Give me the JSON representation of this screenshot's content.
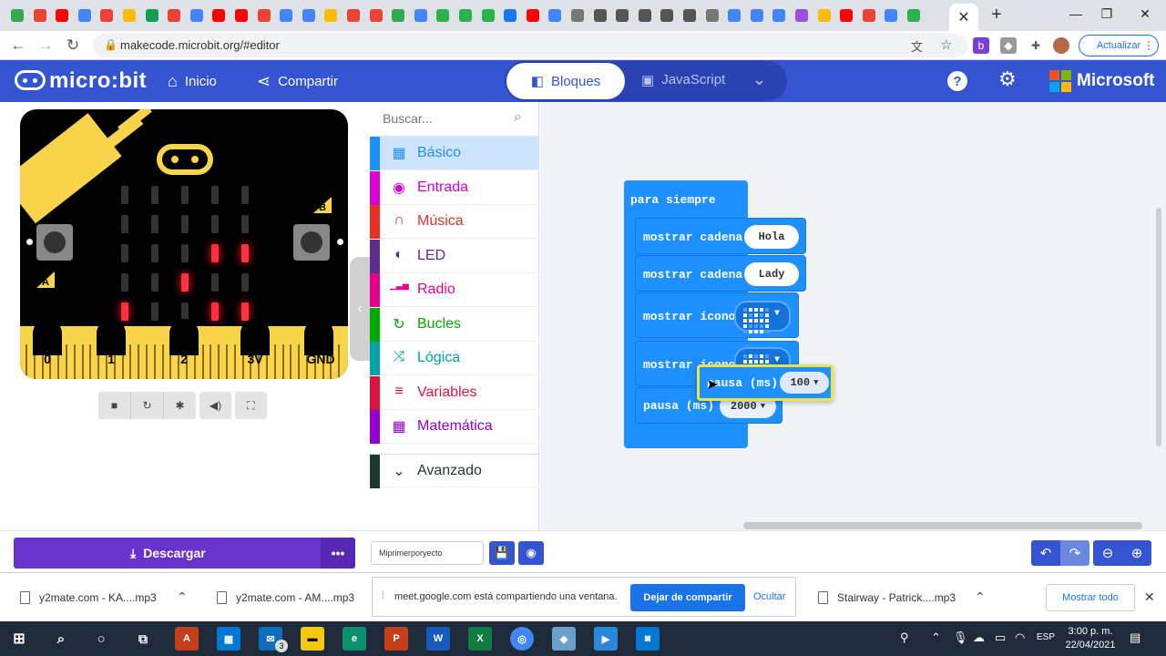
{
  "browser": {
    "url": "makecode.microbit.org/#editor",
    "update_label": "Actualizar",
    "tab_colors": [
      "#34a853",
      "#ea4335",
      "#ff0000",
      "#4285f4",
      "#ea4335",
      "#fbbc05",
      "#0f9d58",
      "#ea4335",
      "#4285f4",
      "#ff0000",
      "#ff0000",
      "#ea4335",
      "#4285f4",
      "#4285f4",
      "#fbbc05",
      "#ea4335",
      "#ea4335",
      "#34a853",
      "#4285f4",
      "#2bb24c",
      "#2bb24c",
      "#2bb24c",
      "#1877f2",
      "#ff0000",
      "#4285f4",
      "#777777",
      "#555555",
      "#555555",
      "#555555",
      "#555555",
      "#555555",
      "#777777",
      "#4285f4",
      "#4285f4",
      "#4285f4",
      "#9b51e0",
      "#fbbc05",
      "#ff0000",
      "#ea4335",
      "#4285f4",
      "#2bb24c"
    ]
  },
  "header": {
    "logo_text": "micro:bit",
    "home_label": "Inicio",
    "share_label": "Compartir",
    "blocks_tab": "Bloques",
    "js_tab": "JavaScript",
    "ms_label": "Microsoft"
  },
  "simulator": {
    "pins": [
      "0",
      "1",
      "2",
      "3V",
      "GND"
    ],
    "button_a": "A",
    "button_b": "B",
    "led_on": [
      [
        2,
        3
      ],
      [
        2,
        4
      ],
      [
        3,
        2
      ],
      [
        4,
        0
      ],
      [
        4,
        3
      ],
      [
        4,
        4
      ]
    ]
  },
  "toolbox": {
    "search_placeholder": "Buscar...",
    "categories": [
      {
        "label": "Básico",
        "color": "#1e90ff",
        "icon": "grid-icon"
      },
      {
        "label": "Entrada",
        "color": "#d400d4",
        "icon": "target-icon"
      },
      {
        "label": "Música",
        "color": "#e63022",
        "icon": "headphones-icon"
      },
      {
        "label": "LED",
        "color": "#5c2d91",
        "icon": "toggle-icon"
      },
      {
        "label": "Radio",
        "color": "#e3008c",
        "icon": "signal-icon"
      },
      {
        "label": "Bucles",
        "color": "#00aa00",
        "icon": "loop-icon"
      },
      {
        "label": "Lógica",
        "color": "#00a4a6",
        "icon": "shuffle-icon"
      },
      {
        "label": "Variables",
        "color": "#dc143c",
        "icon": "list-icon"
      },
      {
        "label": "Matemática",
        "color": "#9400d3",
        "icon": "calculator-icon"
      }
    ],
    "advanced_label": "Avanzado",
    "advanced_color": "#1d3a2e"
  },
  "workspace": {
    "forever_label": "para siempre",
    "show_string_label": "mostrar cadena",
    "string1": "Hola",
    "string2": "Lady",
    "show_icon_label": "mostrar ícono",
    "pause_label": "pausa (ms)",
    "pause_value_1": "2000",
    "pause_value_2": "100",
    "icon1": [
      0,
      1,
      1,
      1,
      0,
      1,
      0,
      1,
      0,
      1,
      1,
      1,
      1,
      1,
      1,
      1,
      0,
      0,
      0,
      1,
      0,
      1,
      1,
      1,
      0
    ],
    "icon2": [
      0,
      1,
      0,
      1,
      0,
      1,
      1,
      1,
      1,
      1,
      1,
      1,
      1,
      1,
      1,
      0,
      1,
      1,
      1,
      0,
      0,
      0,
      1,
      0,
      0
    ]
  },
  "bottombar": {
    "download_label": "Descargar",
    "project_name": "Miprimerporyecto"
  },
  "downloads": {
    "items": [
      "y2mate.com - KA....mp3",
      "y2mate.com - AM....mp3",
      "Stairway - Patrick....mp3"
    ],
    "share_notice": "meet.google.com está compartiendo una ventana.",
    "stop_share": "Dejar de compartir",
    "hide": "Ocultar",
    "show_all": "Mostrar todo"
  },
  "taskbar": {
    "lang": "ESP",
    "time": "3:00 p. m.",
    "date": "22/04/2021",
    "mail_badge": "3"
  }
}
